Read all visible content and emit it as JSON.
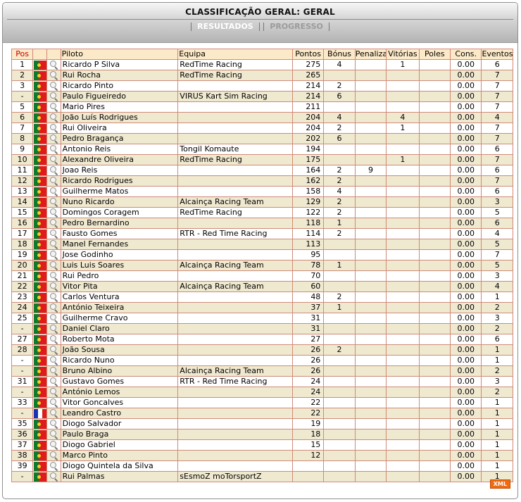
{
  "header": {
    "title": "CLASSIFICAÇÃO GERAL: GERAL",
    "tabs": [
      {
        "label": "RESULTADOS",
        "active": true
      },
      {
        "label": "PROGRESSO",
        "active": false
      }
    ]
  },
  "table": {
    "columns": [
      "Pos",
      "",
      "",
      "Piloto",
      "Equipa",
      "Pontos",
      "Bónus",
      "Penalizações",
      "Vitórias",
      "Poles",
      "Cons.",
      "Eventos"
    ],
    "rows": [
      {
        "pos": "1",
        "flag": "pt",
        "driver": "Ricardo P Silva",
        "team": "RedTime Racing",
        "points": "275",
        "bonus": "4",
        "pen": "",
        "wins": "1",
        "poles": "",
        "cons": "0.00",
        "events": "6"
      },
      {
        "pos": "2",
        "flag": "pt",
        "driver": "Rui Rocha",
        "team": "RedTime Racing",
        "points": "265",
        "bonus": "",
        "pen": "",
        "wins": "",
        "poles": "",
        "cons": "0.00",
        "events": "7"
      },
      {
        "pos": "3",
        "flag": "pt",
        "driver": "Ricardo Pinto",
        "team": "",
        "points": "214",
        "bonus": "2",
        "pen": "",
        "wins": "",
        "poles": "",
        "cons": "0.00",
        "events": "7"
      },
      {
        "pos": "-",
        "flag": "pt",
        "driver": "Paulo Figueiredo",
        "team": "VIRUS Kart Sim Racing",
        "points": "214",
        "bonus": "6",
        "pen": "",
        "wins": "",
        "poles": "",
        "cons": "0.00",
        "events": "7"
      },
      {
        "pos": "5",
        "flag": "pt",
        "driver": "Mario Pires",
        "team": "",
        "points": "211",
        "bonus": "",
        "pen": "",
        "wins": "",
        "poles": "",
        "cons": "0.00",
        "events": "7"
      },
      {
        "pos": "6",
        "flag": "pt",
        "driver": "João Luís Rodrigues",
        "team": "",
        "points": "204",
        "bonus": "4",
        "pen": "",
        "wins": "4",
        "poles": "",
        "cons": "0.00",
        "events": "4"
      },
      {
        "pos": "7",
        "flag": "pt",
        "driver": "Rui Oliveira",
        "team": "",
        "points": "204",
        "bonus": "2",
        "pen": "",
        "wins": "1",
        "poles": "",
        "cons": "0.00",
        "events": "7"
      },
      {
        "pos": "8",
        "flag": "pt",
        "driver": "Pedro Bragança",
        "team": "",
        "points": "202",
        "bonus": "6",
        "pen": "",
        "wins": "",
        "poles": "",
        "cons": "0.00",
        "events": "7"
      },
      {
        "pos": "9",
        "flag": "pt",
        "driver": "Antonio Reis",
        "team": "Tongil Komaute",
        "points": "194",
        "bonus": "",
        "pen": "",
        "wins": "",
        "poles": "",
        "cons": "0.00",
        "events": "6"
      },
      {
        "pos": "10",
        "flag": "pt",
        "driver": "Alexandre Oliveira",
        "team": "RedTime Racing",
        "points": "175",
        "bonus": "",
        "pen": "",
        "wins": "1",
        "poles": "",
        "cons": "0.00",
        "events": "7"
      },
      {
        "pos": "11",
        "flag": "pt",
        "driver": "Joao Reis",
        "team": "",
        "points": "164",
        "bonus": "2",
        "pen": "9",
        "wins": "",
        "poles": "",
        "cons": "0.00",
        "events": "6"
      },
      {
        "pos": "12",
        "flag": "pt",
        "driver": "Ricardo Rodrigues",
        "team": "",
        "points": "162",
        "bonus": "2",
        "pen": "",
        "wins": "",
        "poles": "",
        "cons": "0.00",
        "events": "7"
      },
      {
        "pos": "13",
        "flag": "pt",
        "driver": "Guilherme Matos",
        "team": "",
        "points": "158",
        "bonus": "4",
        "pen": "",
        "wins": "",
        "poles": "",
        "cons": "0.00",
        "events": "6"
      },
      {
        "pos": "14",
        "flag": "pt",
        "driver": "Nuno Ricardo",
        "team": "Alcainça Racing Team",
        "points": "129",
        "bonus": "2",
        "pen": "",
        "wins": "",
        "poles": "",
        "cons": "0.00",
        "events": "3"
      },
      {
        "pos": "15",
        "flag": "pt",
        "driver": "Domingos Coragem",
        "team": "RedTime Racing",
        "points": "122",
        "bonus": "2",
        "pen": "",
        "wins": "",
        "poles": "",
        "cons": "0.00",
        "events": "5"
      },
      {
        "pos": "16",
        "flag": "pt",
        "driver": "Pedro Bernardino",
        "team": "",
        "points": "118",
        "bonus": "1",
        "pen": "",
        "wins": "",
        "poles": "",
        "cons": "0.00",
        "events": "6"
      },
      {
        "pos": "17",
        "flag": "pt",
        "driver": "Fausto Gomes",
        "team": "RTR - Red Time Racing",
        "points": "114",
        "bonus": "2",
        "pen": "",
        "wins": "",
        "poles": "",
        "cons": "0.00",
        "events": "4"
      },
      {
        "pos": "18",
        "flag": "pt",
        "driver": "Manel Fernandes",
        "team": "",
        "points": "113",
        "bonus": "",
        "pen": "",
        "wins": "",
        "poles": "",
        "cons": "0.00",
        "events": "5"
      },
      {
        "pos": "19",
        "flag": "pt",
        "driver": "Jose Godinho",
        "team": "",
        "points": "95",
        "bonus": "",
        "pen": "",
        "wins": "",
        "poles": "",
        "cons": "0.00",
        "events": "7"
      },
      {
        "pos": "20",
        "flag": "pt",
        "driver": "Luis Luis Soares",
        "team": "Alcainça Racing Team",
        "points": "78",
        "bonus": "1",
        "pen": "",
        "wins": "",
        "poles": "",
        "cons": "0.00",
        "events": "5"
      },
      {
        "pos": "21",
        "flag": "pt",
        "driver": "Rui Pedro",
        "team": "",
        "points": "70",
        "bonus": "",
        "pen": "",
        "wins": "",
        "poles": "",
        "cons": "0.00",
        "events": "3"
      },
      {
        "pos": "22",
        "flag": "pt",
        "driver": "Vitor Pita",
        "team": "Alcainça Racing Team",
        "points": "60",
        "bonus": "",
        "pen": "",
        "wins": "",
        "poles": "",
        "cons": "0.00",
        "events": "4"
      },
      {
        "pos": "23",
        "flag": "pt",
        "driver": "Carlos Ventura",
        "team": "",
        "points": "48",
        "bonus": "2",
        "pen": "",
        "wins": "",
        "poles": "",
        "cons": "0.00",
        "events": "1"
      },
      {
        "pos": "24",
        "flag": "pt",
        "driver": "António Teixeira",
        "team": "",
        "points": "37",
        "bonus": "1",
        "pen": "",
        "wins": "",
        "poles": "",
        "cons": "0.00",
        "events": "2"
      },
      {
        "pos": "25",
        "flag": "pt",
        "driver": "Guilherme Cravo",
        "team": "",
        "points": "31",
        "bonus": "",
        "pen": "",
        "wins": "",
        "poles": "",
        "cons": "0.00",
        "events": "3"
      },
      {
        "pos": "-",
        "flag": "pt",
        "driver": "Daniel Claro",
        "team": "",
        "points": "31",
        "bonus": "",
        "pen": "",
        "wins": "",
        "poles": "",
        "cons": "0.00",
        "events": "2"
      },
      {
        "pos": "27",
        "flag": "pt",
        "driver": "Roberto Mota",
        "team": "",
        "points": "27",
        "bonus": "",
        "pen": "",
        "wins": "",
        "poles": "",
        "cons": "0.00",
        "events": "6"
      },
      {
        "pos": "28",
        "flag": "pt",
        "driver": "João Sousa",
        "team": "",
        "points": "26",
        "bonus": "2",
        "pen": "",
        "wins": "",
        "poles": "",
        "cons": "0.00",
        "events": "1"
      },
      {
        "pos": "-",
        "flag": "pt",
        "driver": "Ricardo Nuno",
        "team": "",
        "points": "26",
        "bonus": "",
        "pen": "",
        "wins": "",
        "poles": "",
        "cons": "0.00",
        "events": "1"
      },
      {
        "pos": "-",
        "flag": "pt",
        "driver": "Bruno Albino",
        "team": "Alcainça Racing Team",
        "points": "26",
        "bonus": "",
        "pen": "",
        "wins": "",
        "poles": "",
        "cons": "0.00",
        "events": "2"
      },
      {
        "pos": "31",
        "flag": "pt",
        "driver": "Gustavo Gomes",
        "team": "RTR - Red Time Racing",
        "points": "24",
        "bonus": "",
        "pen": "",
        "wins": "",
        "poles": "",
        "cons": "0.00",
        "events": "3"
      },
      {
        "pos": "-",
        "flag": "pt",
        "driver": "António Lemos",
        "team": "",
        "points": "24",
        "bonus": "",
        "pen": "",
        "wins": "",
        "poles": "",
        "cons": "0.00",
        "events": "2"
      },
      {
        "pos": "33",
        "flag": "pt",
        "driver": "Vitor Goncalves",
        "team": "",
        "points": "22",
        "bonus": "",
        "pen": "",
        "wins": "",
        "poles": "",
        "cons": "0.00",
        "events": "1"
      },
      {
        "pos": "-",
        "flag": "fr",
        "driver": "Leandro Castro",
        "team": "",
        "points": "22",
        "bonus": "",
        "pen": "",
        "wins": "",
        "poles": "",
        "cons": "0.00",
        "events": "1"
      },
      {
        "pos": "35",
        "flag": "pt",
        "driver": "Diogo Salvador",
        "team": "",
        "points": "19",
        "bonus": "",
        "pen": "",
        "wins": "",
        "poles": "",
        "cons": "0.00",
        "events": "1"
      },
      {
        "pos": "36",
        "flag": "pt",
        "driver": "Paulo Braga",
        "team": "",
        "points": "18",
        "bonus": "",
        "pen": "",
        "wins": "",
        "poles": "",
        "cons": "0.00",
        "events": "1"
      },
      {
        "pos": "37",
        "flag": "pt",
        "driver": "Diogo Gabriel",
        "team": "",
        "points": "15",
        "bonus": "",
        "pen": "",
        "wins": "",
        "poles": "",
        "cons": "0.00",
        "events": "1"
      },
      {
        "pos": "38",
        "flag": "pt",
        "driver": "Marco Pinto",
        "team": "",
        "points": "12",
        "bonus": "",
        "pen": "",
        "wins": "",
        "poles": "",
        "cons": "0.00",
        "events": "1"
      },
      {
        "pos": "39",
        "flag": "pt",
        "driver": "Diogo Quintela da Silva",
        "team": "",
        "points": "",
        "bonus": "",
        "pen": "",
        "wins": "",
        "poles": "",
        "cons": "0.00",
        "events": "1"
      },
      {
        "pos": "-",
        "flag": "pt",
        "driver": "Rui Palmas",
        "team": "sEsmoZ moTorsportZ",
        "points": "",
        "bonus": "",
        "pen": "",
        "wins": "",
        "poles": "",
        "cons": "0.00",
        "events": "1"
      }
    ]
  },
  "footer": {
    "xml_label": "XML"
  },
  "colors": {
    "header_row_bg": "#fbe9c7",
    "row_alt_bg": "#efe9d0",
    "border": "#d08a78",
    "pos_header": "#c40000",
    "xml_button": "#f26b10"
  }
}
